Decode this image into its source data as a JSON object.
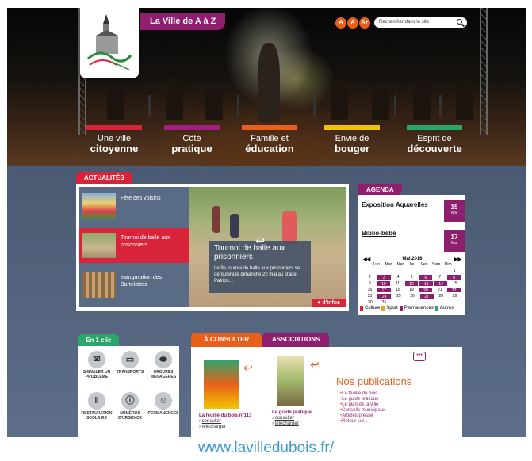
{
  "header": {
    "az_label": "La Ville de A à Z",
    "font_sizes": [
      "A",
      "A",
      "A+"
    ],
    "search_placeholder": "Rechercher dans le site"
  },
  "nav": [
    {
      "line1": "Une ville",
      "line2": "citoyenne",
      "color": "#d8243a"
    },
    {
      "line1": "Côté",
      "line2": "pratique",
      "color": "#a0207f"
    },
    {
      "line1": "Famille et",
      "line2": "éducation",
      "color": "#e8601c"
    },
    {
      "line1": "Envie de",
      "line2": "bouger",
      "color": "#f2c500"
    },
    {
      "line1": "Esprit de",
      "line2": "découverte",
      "color": "#2aa66a"
    }
  ],
  "news": {
    "tab": "ACTUALITÉS",
    "items": [
      "Fête des voisins",
      "Tournoi de balle aux prisonniers",
      "Inauguration des Bartelottes"
    ],
    "featured_title": "Tournoi de balle aux prisonniers",
    "featured_text": "Le 9e tournoi de balle aux prisonniers se déroulera le dimanche 22 mai au stade Patrick....",
    "more": "+ d'infos"
  },
  "agenda": {
    "tab": "AGENDA",
    "events": [
      {
        "title": "Exposition Aquarelles",
        "day": "15",
        "month": "Mai"
      },
      {
        "title": "Biblio-bébé",
        "day": "17",
        "month": "Mai"
      }
    ],
    "calendar": {
      "title": "Mai 2016",
      "days": [
        "Lun",
        "Mar",
        "Mer",
        "Jeu",
        "Ven",
        "Sam",
        "Dim"
      ],
      "weeks": [
        [
          "",
          "",
          "",
          "",
          "",
          "",
          "1"
        ],
        [
          "2",
          "3",
          "4",
          "5",
          "6",
          "7",
          "8"
        ],
        [
          "9",
          "10",
          "11",
          "12",
          "13",
          "14",
          "15"
        ],
        [
          "16",
          "17",
          "18",
          "19",
          "20",
          "21",
          "22"
        ],
        [
          "23",
          "24",
          "25",
          "26",
          "27",
          "28",
          "29"
        ],
        [
          "30",
          "31",
          "",
          "",
          "",
          "",
          ""
        ]
      ]
    },
    "legend": [
      {
        "label": "Culture",
        "color": "#d8243a"
      },
      {
        "label": "Sport",
        "color": "#e8a21c"
      },
      {
        "label": "Permanences",
        "color": "#8e1e6e"
      },
      {
        "label": "Autres",
        "color": "#2aa66a"
      }
    ]
  },
  "quick": {
    "title": "En 1 clic",
    "items": [
      {
        "label": "SIGNALER UN PROBLÈME",
        "icon": "✉",
        "name": "signaler-probleme-icon"
      },
      {
        "label": "TRANSPORTS",
        "icon": "🚌",
        "name": "bus-icon"
      },
      {
        "label": "ORDURES MÉNAGÈRES",
        "icon": "♻",
        "name": "trash-bag-icon"
      },
      {
        "label": "RESTAURATION SCOLAIRE",
        "icon": "🍴",
        "name": "cutlery-icon"
      },
      {
        "label": "NUMÉROS D'URGENCE",
        "icon": "ⓘ",
        "name": "emergency-numbers-icon"
      },
      {
        "label": "PERMANENCES",
        "icon": "☺",
        "name": "permanences-icon"
      }
    ]
  },
  "pubs": {
    "tab1": "À CONSULTER",
    "tab2": "ASSOCIATIONS",
    "heading": "Nos publications",
    "pub1": {
      "title": "La feuille du bois n°113",
      "consult": "consulter",
      "dl": "télécharger"
    },
    "pub2": {
      "title": "Le guide pratique",
      "consult": "consulter",
      "dl": "télécharger"
    },
    "links": [
      "La feuille du bois",
      "Le guide pratique",
      "Le plan de la ville",
      "Conseils municipaux",
      "Articles presse",
      "Retour sur..."
    ]
  },
  "footer_url": "www.lavilledubois.fr/"
}
